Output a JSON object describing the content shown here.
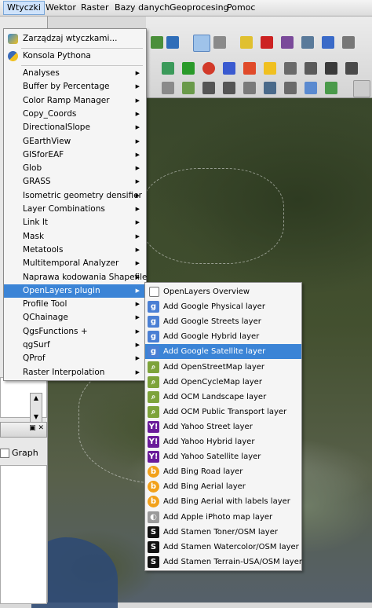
{
  "menubar": {
    "items": [
      "Wtyczki",
      "Wektor",
      "Raster",
      "Bazy danych",
      "Geoprocesing",
      "Pomoc"
    ]
  },
  "plugins_menu": {
    "manage": "Zarządzaj wtyczkami...",
    "console": "Konsola Pythona",
    "items": [
      "Analyses",
      "Buffer by Percentage",
      "Color Ramp Manager",
      "Copy_Coords",
      "DirectionalSlope",
      "GEarthView",
      "GISforEAF",
      "Glob",
      "GRASS",
      "Isometric geometry densifier",
      "Layer Combinations",
      "Link It",
      "Mask",
      "Metatools",
      "Multitemporal Analyzer",
      "Naprawa kodowania Shapefile",
      "OpenLayers plugin",
      "Profile Tool",
      "QChainage",
      "QgsFunctions +",
      "qgSurf",
      "QProf",
      "Raster Interpolation"
    ],
    "highlighted": "OpenLayers plugin"
  },
  "openlayers_menu": {
    "items": [
      {
        "label": "OpenLayers Overview",
        "icon": "checkbox-icon",
        "color": "#ffffff"
      },
      {
        "label": "Add Google Physical layer",
        "icon": "google-icon",
        "color": "#4a7fd4"
      },
      {
        "label": "Add Google Streets layer",
        "icon": "google-icon",
        "color": "#4a7fd4"
      },
      {
        "label": "Add Google Hybrid layer",
        "icon": "google-icon",
        "color": "#4a7fd4"
      },
      {
        "label": "Add Google Satellite layer",
        "icon": "google-icon",
        "color": "#4a7fd4"
      },
      {
        "label": "Add OpenStreetMap layer",
        "icon": "osm-icon",
        "color": "#7da33a"
      },
      {
        "label": "Add OpenCycleMap layer",
        "icon": "osm-icon",
        "color": "#7da33a"
      },
      {
        "label": "Add OCM Landscape layer",
        "icon": "osm-icon",
        "color": "#7da33a"
      },
      {
        "label": "Add OCM Public Transport layer",
        "icon": "osm-icon",
        "color": "#7da33a"
      },
      {
        "label": "Add Yahoo Street layer",
        "icon": "yahoo-icon",
        "color": "#6a1b9a"
      },
      {
        "label": "Add Yahoo Hybrid layer",
        "icon": "yahoo-icon",
        "color": "#6a1b9a"
      },
      {
        "label": "Add Yahoo Satellite layer",
        "icon": "yahoo-icon",
        "color": "#6a1b9a"
      },
      {
        "label": "Add Bing Road layer",
        "icon": "bing-icon",
        "color": "#f2a11a"
      },
      {
        "label": "Add Bing Aerial layer",
        "icon": "bing-icon",
        "color": "#f2a11a"
      },
      {
        "label": "Add Bing Aerial with labels layer",
        "icon": "bing-icon",
        "color": "#f2a11a"
      },
      {
        "label": "Add Apple iPhoto map layer",
        "icon": "apple-icon",
        "color": "#9a9a9a"
      },
      {
        "label": "Add Stamen Toner/OSM layer",
        "icon": "stamen-icon",
        "color": "#111111"
      },
      {
        "label": "Add Stamen Watercolor/OSM layer",
        "icon": "stamen-icon",
        "color": "#111111"
      },
      {
        "label": "Add Stamen Terrain-USA/OSM layer",
        "icon": "stamen-icon",
        "color": "#111111"
      }
    ],
    "highlighted": "Add Google Satellite layer"
  },
  "left_panel": {
    "graph_label": "Graph"
  },
  "colors": {
    "highlight": "#3b84d6",
    "menu_bg": "#f5f5f5"
  }
}
